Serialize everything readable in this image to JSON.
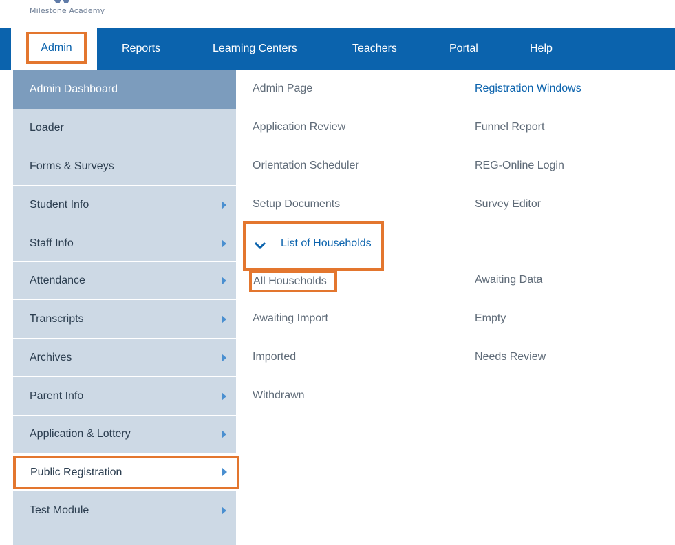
{
  "logo": {
    "name": "Milestone Academy",
    "icon": "milestone-logo-mark"
  },
  "colors": {
    "nav_background": "#0b63ad",
    "highlight_border": "#e3762e",
    "left_menu_background": "#cdd9e5",
    "left_menu_active": "#7c9cbd",
    "link_blue": "#0b63ad",
    "link_gray": "#5f6b78"
  },
  "topnav": {
    "items": [
      {
        "label": "Admin",
        "active": true
      },
      {
        "label": "Reports"
      },
      {
        "label": "Learning Centers"
      },
      {
        "label": "Teachers"
      },
      {
        "label": "Portal"
      },
      {
        "label": "Help"
      }
    ]
  },
  "leftmenu": {
    "items": [
      {
        "label": "Admin Dashboard",
        "active": true,
        "has_submenu": false
      },
      {
        "label": "Loader",
        "has_submenu": false
      },
      {
        "label": "Forms & Surveys",
        "has_submenu": false
      },
      {
        "label": "Student Info",
        "has_submenu": true
      },
      {
        "label": "Staff Info",
        "has_submenu": true
      },
      {
        "label": "Attendance",
        "has_submenu": true
      },
      {
        "label": "Transcripts",
        "has_submenu": true
      },
      {
        "label": "Archives",
        "has_submenu": true
      },
      {
        "label": "Parent Info",
        "has_submenu": true
      },
      {
        "label": "Application & Lottery",
        "has_submenu": true
      },
      {
        "label": "Public Registration",
        "has_submenu": true,
        "highlighted": true
      },
      {
        "label": "Test Module",
        "has_submenu": true
      }
    ],
    "arrow_icon": "caret-right-icon"
  },
  "submenu": {
    "col1": [
      {
        "label": "Admin Page"
      },
      {
        "label": "Application Review"
      },
      {
        "label": "Orientation Scheduler"
      },
      {
        "label": "Setup Documents"
      }
    ],
    "col2": [
      {
        "label": "Registration Windows"
      },
      {
        "label": "Funnel Report"
      },
      {
        "label": "REG-Online Login"
      },
      {
        "label": "Survey Editor"
      }
    ],
    "list_of_households": {
      "label": "List of Households",
      "icon": "chevron-down-icon",
      "expanded": true
    },
    "households_col1": [
      {
        "label": "All Households"
      },
      {
        "label": "Awaiting Import"
      },
      {
        "label": "Imported"
      },
      {
        "label": "Withdrawn"
      }
    ],
    "households_col2": [
      {
        "label": "Awaiting Data"
      },
      {
        "label": "Empty"
      },
      {
        "label": "Needs Review"
      }
    ]
  }
}
